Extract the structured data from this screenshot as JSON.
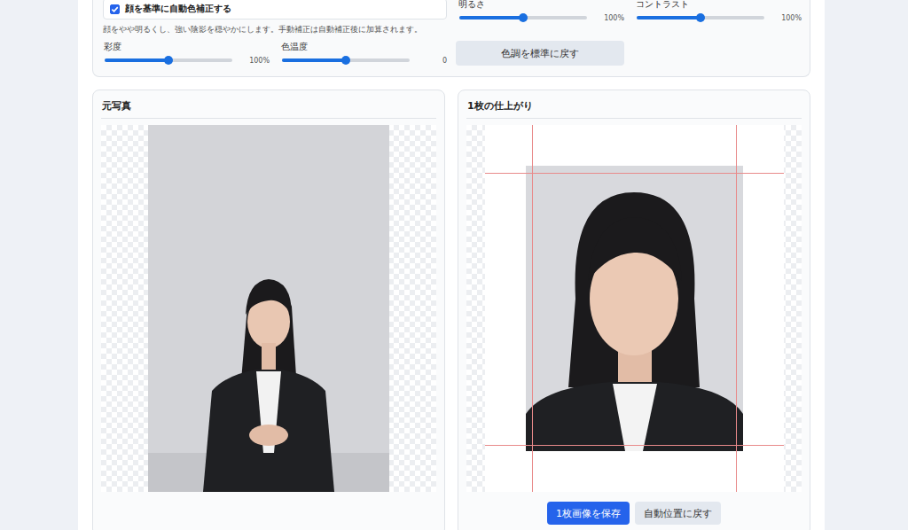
{
  "color_correction": {
    "auto": {
      "label": "顔を基準に自動色補正する",
      "checked": true
    },
    "help": "顔をやや明るくし、強い陰影を穏やかにします。手動補正は自動補正後に加算されます。",
    "sliders": [
      {
        "label": "明るさ",
        "level": 0.5,
        "reading": "100%"
      },
      {
        "label": "コントラスト",
        "level": 0.5,
        "reading": "100%"
      },
      {
        "label": "彩度",
        "level": 0.5,
        "reading": "100%"
      },
      {
        "label": "色温度",
        "level": 0.5,
        "reading": "0"
      }
    ],
    "reset_button": "色調を標準に戻す"
  },
  "panels": {
    "original": {
      "title": "元写真"
    },
    "result": {
      "title": "1枚の仕上がり",
      "buttons": [
        {
          "label": "1枚画像を保存",
          "kind": "primary"
        },
        {
          "label": "自動位置に戻す",
          "kind": "secondary"
        }
      ]
    }
  }
}
